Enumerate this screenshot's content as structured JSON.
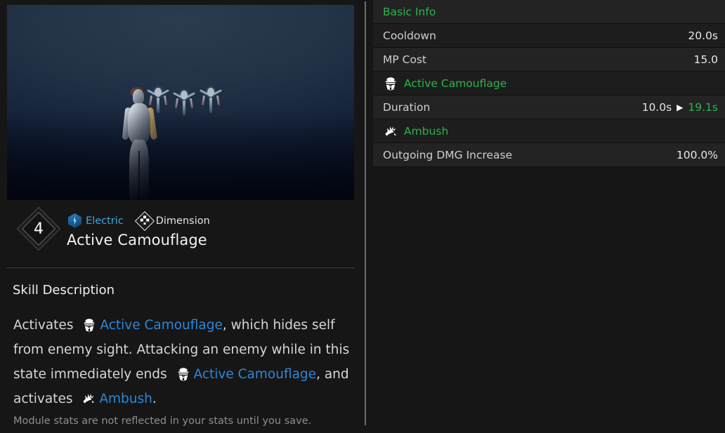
{
  "preview": {
    "alt": "skill-preview-render",
    "description": "Character in silver armor with three hovering enemy wisps on a dark blue gradient background"
  },
  "skill": {
    "level": "4",
    "name": "Active Camouflage",
    "tags": [
      {
        "label": "Electric",
        "icon": "electric-icon",
        "color": "#3fa9e0"
      },
      {
        "label": "Dimension",
        "icon": "dimension-icon",
        "color": "#e4e4e4"
      }
    ]
  },
  "description": {
    "heading": "Skill Description",
    "segments": [
      {
        "type": "text",
        "value": "Activates"
      },
      {
        "type": "icon",
        "value": "camouflage-icon"
      },
      {
        "type": "link",
        "value": "Active Camouflage"
      },
      {
        "type": "text",
        "value": ", which hides self from enemy sight. Attacking an enemy while in this state immediately ends"
      },
      {
        "type": "icon",
        "value": "camouflage-icon"
      },
      {
        "type": "link",
        "value": "Active Camouflage"
      },
      {
        "type": "text",
        "value": ", and activates"
      },
      {
        "type": "icon",
        "value": "ambush-icon"
      },
      {
        "type": "link",
        "value": "Ambush"
      },
      {
        "type": "text",
        "value": "."
      }
    ],
    "footer_note": "Module stats are not reflected in your stats until you save."
  },
  "stats": {
    "rows": [
      {
        "kind": "section",
        "label": "Basic Info",
        "icon": null,
        "value": null
      },
      {
        "kind": "stat",
        "label": "Cooldown",
        "icon": null,
        "value": "20.0s"
      },
      {
        "kind": "stat",
        "label": "MP Cost",
        "icon": null,
        "value": "15.0"
      },
      {
        "kind": "section",
        "label": "Active Camouflage",
        "icon": "camouflage-icon",
        "value": null
      },
      {
        "kind": "stat",
        "label": "Duration",
        "icon": null,
        "value_from": "10.0s",
        "value_arrow": "▶",
        "value_to": "19.1s"
      },
      {
        "kind": "section",
        "label": "Ambush",
        "icon": "ambush-icon",
        "value": null
      },
      {
        "kind": "stat",
        "label": "Outgoing DMG Increase",
        "icon": null,
        "value": "100.0%"
      }
    ]
  },
  "colors": {
    "accent_green": "#2cb34e",
    "link_blue": "#2e86d8",
    "electric_blue": "#3fa9e0",
    "background": "#161616",
    "row_light": "#232323",
    "row_dark": "#1d1d1d"
  }
}
